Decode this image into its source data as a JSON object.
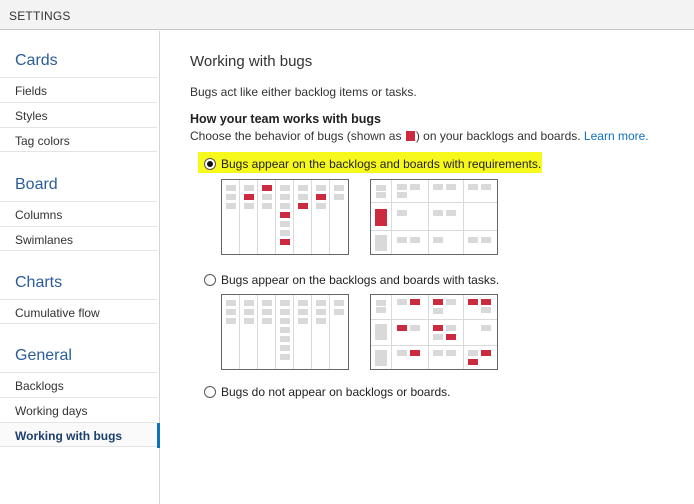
{
  "window": {
    "title": "SETTINGS"
  },
  "sidebar": {
    "sections": [
      {
        "header": "Cards",
        "items": [
          "Fields",
          "Styles",
          "Tag colors"
        ]
      },
      {
        "header": "Board",
        "items": [
          "Columns",
          "Swimlanes"
        ]
      },
      {
        "header": "Charts",
        "items": [
          "Cumulative flow"
        ]
      },
      {
        "header": "General",
        "items": [
          "Backlogs",
          "Working days",
          "Working with bugs"
        ]
      }
    ],
    "selected_item": "Working with bugs"
  },
  "main": {
    "title": "Working with bugs",
    "intro": "Bugs act like either backlog items or tasks.",
    "subheading": "How your team works with bugs",
    "desc_before": "Choose the behavior of bugs (shown as",
    "desc_after": ") on your backlogs and boards.",
    "learn_more": "Learn more.",
    "options": [
      {
        "label": "Bugs appear on the backlogs and boards with requirements.",
        "checked": true
      },
      {
        "label": "Bugs appear on the backlogs and boards with tasks.",
        "checked": false
      },
      {
        "label": "Bugs do not appear on backlogs or boards.",
        "checked": false
      }
    ]
  },
  "colors": {
    "accent": "#0e70c0",
    "bug": "#cc2a3e",
    "highlight": "#f7f81c",
    "card": "#d9d9d9"
  }
}
